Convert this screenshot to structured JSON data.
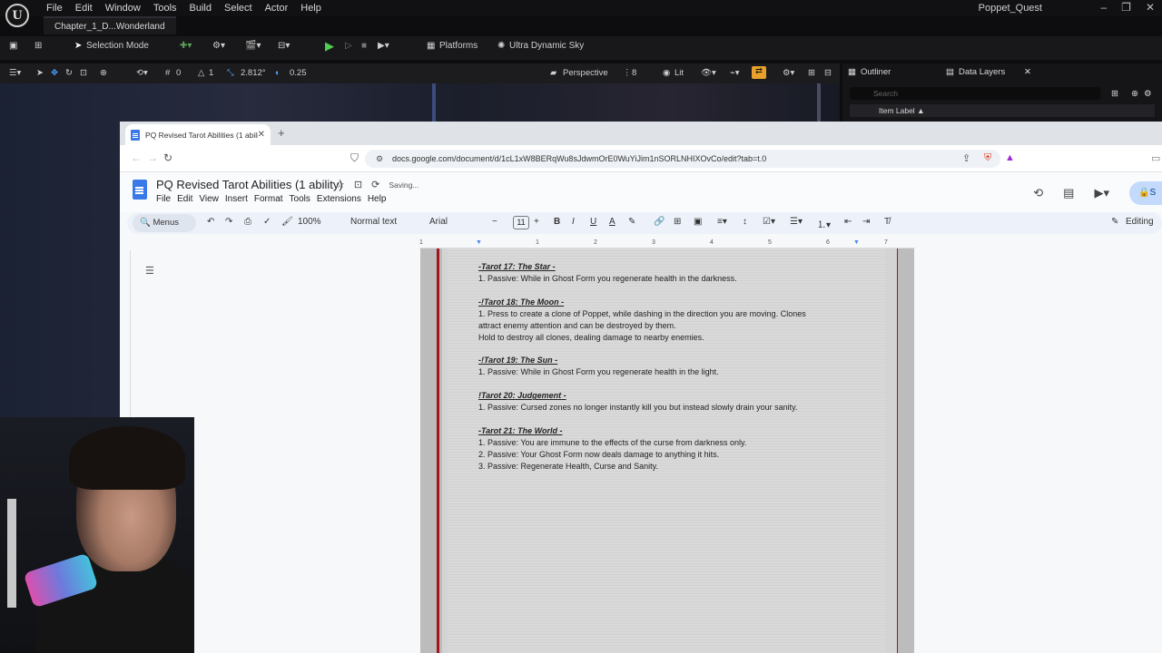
{
  "unreal": {
    "menus": [
      "File",
      "Edit",
      "Window",
      "Tools",
      "Build",
      "Select",
      "Actor",
      "Help"
    ],
    "project": "Poppet_Quest",
    "level_tab": "Chapter_1_D...Wonderland",
    "toolbar": {
      "mode": "Selection Mode",
      "platforms": "Platforms",
      "sky": "Ultra Dynamic Sky"
    },
    "viewport": {
      "perspective": "Perspective",
      "lit": "Lit",
      "snap_grid": "0",
      "snap_rot": "1",
      "snap_scale": "2.812°",
      "camera_speed": "0.25",
      "screen_pct": "8"
    },
    "outliner": {
      "tab1": "Outliner",
      "tab2": "Data Layers",
      "search_placeholder": "Search",
      "column": "Item Label"
    }
  },
  "browser": {
    "tab_title": "PQ Revised Tarot Abilities (1 abili",
    "url": "docs.google.com/document/d/1cL1xW8BERqWu8sJdwmOrE0WuYiJim1nSORLNHIXOvCo/edit?tab=t.0"
  },
  "docs": {
    "title": "PQ Revised Tarot Abilities (1 ability)",
    "saving": "Saving...",
    "menus": [
      "File",
      "Edit",
      "View",
      "Insert",
      "Format",
      "Tools",
      "Extensions",
      "Help"
    ],
    "toolbar": {
      "menus_search": "Menus",
      "zoom": "100%",
      "style": "Normal text",
      "font": "Arial",
      "size": "11",
      "mode": "Editing"
    },
    "ruler": [
      "1",
      "1",
      "2",
      "3",
      "4",
      "5",
      "6",
      "7"
    ],
    "lines": [
      {
        "text": "-Tarot 17: The Star -",
        "heading": true
      },
      {
        "text": "1. Passive: While in Ghost Form you regenerate health in the darkness.",
        "heading": false
      },
      {
        "text": "",
        "heading": false
      },
      {
        "text": "-!Tarot 18: The Moon -",
        "heading": true
      },
      {
        "text": "1. Press to create a clone of Poppet, while dashing in the direction you are moving. Clones",
        "heading": false
      },
      {
        "text": "attract enemy attention and can be destroyed by them.",
        "heading": false
      },
      {
        "text": "Hold to destroy all clones, dealing damage to nearby enemies.",
        "heading": false
      },
      {
        "text": "",
        "heading": false
      },
      {
        "text": "-!Tarot 19: The Sun -",
        "heading": true
      },
      {
        "text": "1. Passive: While in Ghost Form you regenerate health in the light.",
        "heading": false
      },
      {
        "text": "",
        "heading": false
      },
      {
        "text": "!Tarot 20: Judgement -",
        "heading": true
      },
      {
        "text": "1. Passive: Cursed zones no longer instantly kill you but instead slowly drain your sanity.",
        "heading": false
      },
      {
        "text": "",
        "heading": false
      },
      {
        "text": "-Tarot 21: The World -",
        "heading": true
      },
      {
        "text": "1. Passive: You are immune to the effects of the curse from darkness only.",
        "heading": false
      },
      {
        "text": "2. Passive: Your Ghost Form now deals damage to anything it hits.",
        "heading": false
      },
      {
        "text": "3. Passive: Regenerate Health, Curse and Sanity.",
        "heading": false
      }
    ]
  }
}
